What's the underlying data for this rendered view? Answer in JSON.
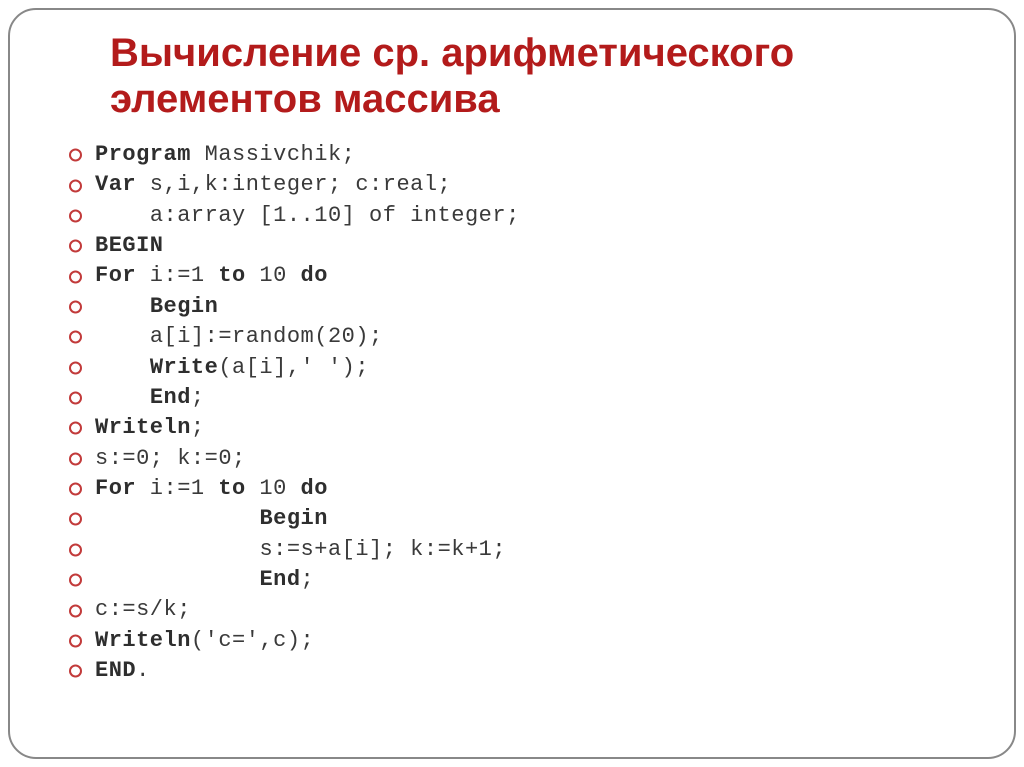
{
  "slide": {
    "title": "Вычисление  ср. арифметического элементов массива"
  },
  "code": {
    "lines": [
      {
        "pre": "",
        "kw": "Program",
        "rest": " Massivchik;"
      },
      {
        "pre": "",
        "kw": "Var",
        "rest": " s,i,k:integer; c:real;"
      },
      {
        "pre": "    ",
        "kw": "",
        "rest": "a:array [1..10] of integer;"
      },
      {
        "pre": "",
        "kw": "BEGIN",
        "rest": ""
      },
      {
        "pre": "",
        "kw": "For",
        "rest": " i:=1 ",
        "kw2": "to",
        "rest2": " 10 ",
        "kw3": "do",
        "rest3": ""
      },
      {
        "pre": "    ",
        "kw": "Begin",
        "rest": ""
      },
      {
        "pre": "    ",
        "kw": "",
        "rest": "a[i]:=random(20);"
      },
      {
        "pre": "    ",
        "kw": "Write",
        "rest": "(a[i],' ');"
      },
      {
        "pre": "    ",
        "kw": "End",
        "rest": ";"
      },
      {
        "pre": "",
        "kw": "Writeln",
        "rest": ";"
      },
      {
        "pre": "",
        "kw": "",
        "rest": "s:=0; k:=0;"
      },
      {
        "pre": "",
        "kw": "For",
        "rest": " i:=1 ",
        "kw2": "to",
        "rest2": " 10 ",
        "kw3": "do",
        "rest3": ""
      },
      {
        "pre": "            ",
        "kw": "Begin",
        "rest": ""
      },
      {
        "pre": "            ",
        "kw": "",
        "rest": "s:=s+a[i]; k:=k+1;"
      },
      {
        "pre": "            ",
        "kw": "End",
        "rest": ";"
      },
      {
        "pre": "",
        "kw": "",
        "rest": "c:=s/k;"
      },
      {
        "pre": "",
        "kw": "Writeln",
        "rest": "('c=',c);"
      },
      {
        "pre": "",
        "kw": "END",
        "rest": "."
      }
    ]
  }
}
